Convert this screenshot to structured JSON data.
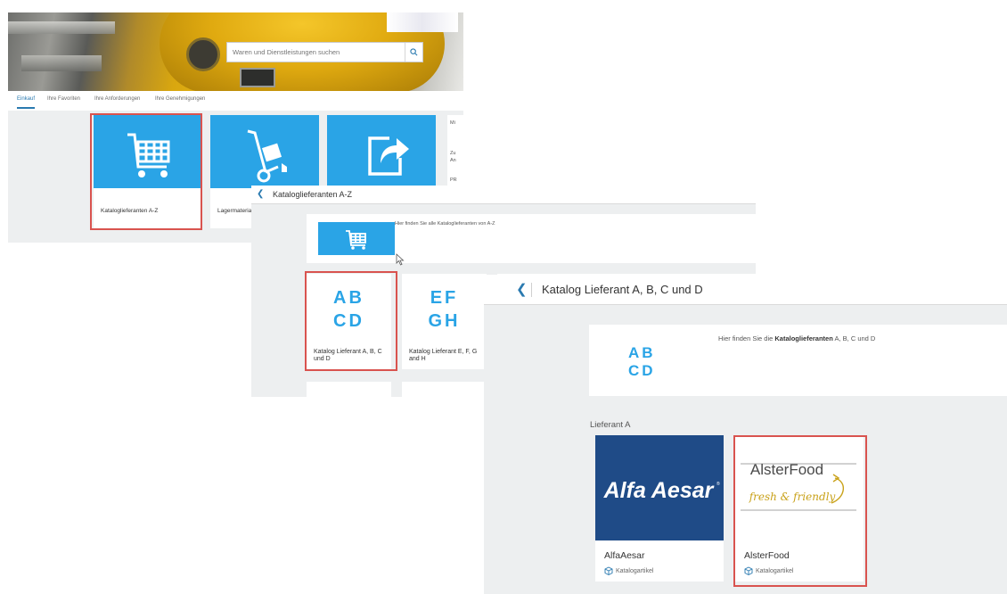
{
  "panel1": {
    "search_placeholder": "Waren und Dienstleistungen suchen",
    "tabs": [
      "Einkauf",
      "Ihre Favoriten",
      "Ihre Anforderungen",
      "Ihre Genehmigungen"
    ],
    "tiles": [
      {
        "label": "Kataloglieferanten A-Z",
        "icon": "shopping-cart-icon"
      },
      {
        "label": "Lagermateria",
        "icon": "hand-truck-icon"
      },
      {
        "label": "",
        "icon": "share-arrow-icon"
      }
    ],
    "side_items": [
      "Mi",
      "Zu",
      "An",
      "PR"
    ]
  },
  "panel2": {
    "title": "Kataloglieferanten A-Z",
    "description": "Hier finden Sie alle Kataloglieferanten von A-Z",
    "tiles": [
      {
        "letters": "AB\nCD",
        "label": "Katalog Lieferant A, B, C und D"
      },
      {
        "letters": "EF\nGH",
        "label": "Katalog Lieferant E, F, G and H"
      }
    ]
  },
  "panel3": {
    "title": "Katalog Lieferant A, B, C und D",
    "letters": "AB\nCD",
    "desc_prefix": "Hier finden Sie die ",
    "desc_bold": "Kataloglieferanten",
    "desc_suffix": " A, B, C und D",
    "section_label": "Lieferant A",
    "suppliers": [
      {
        "name": "AlfaAesar",
        "logo_text": "Alfa Aesar",
        "type": "Katalogartikel"
      },
      {
        "name": "AlsterFood",
        "logo_text": "AlsterFood",
        "logo_tagline": "fresh & friendly",
        "type": "Katalogartikel"
      }
    ]
  },
  "colors": {
    "accent": "#2aa4e6",
    "highlight": "#d9534f",
    "link": "#2a7ab0",
    "alfa_aesar_bg": "#1f4b87",
    "alsterfood_tagline": "#c9a21a"
  }
}
